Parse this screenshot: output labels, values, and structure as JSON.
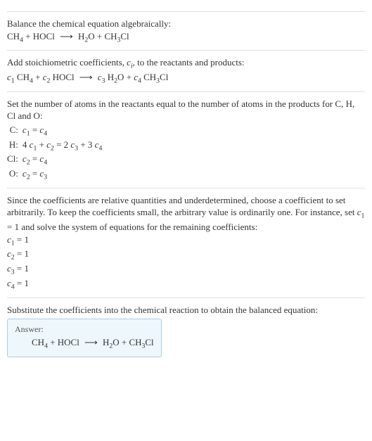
{
  "s1": {
    "intro": "Balance the chemical equation algebraically:",
    "eq_chunks": [
      "CH",
      "4",
      " + HOCl ",
      " H",
      "2",
      "O + CH",
      "3",
      "Cl"
    ]
  },
  "s2": {
    "intro_a": "Add stoichiometric coefficients, ",
    "intro_ci": "c",
    "intro_ci_sub": "i",
    "intro_b": ", to the reactants and products:",
    "eq": {
      "c1": "c",
      "c1s": "1",
      "r1a": " CH",
      "r1b": "4",
      "plus1": " + ",
      "c2": "c",
      "c2s": "2",
      "r2": " HOCl ",
      "c3": "c",
      "c3s": "3",
      "p1a": " H",
      "p1b": "2",
      "p1c": "O",
      "plus2": " + ",
      "c4": "c",
      "c4s": "4",
      "p2a": " CH",
      "p2b": "3",
      "p2c": "Cl"
    }
  },
  "s3": {
    "intro": "Set the number of atoms in the reactants equal to the number of atoms in the products for C, H, Cl and O:",
    "rows": [
      {
        "label": "C:",
        "lhs_pre": "",
        "c": "c",
        "cs": "1",
        "mid": " = ",
        "rc": "c",
        "rcs": "4",
        "tail": ""
      },
      {
        "label": "H:",
        "lhs_pre": "4 ",
        "c": "c",
        "cs": "1",
        "mid": " + ",
        "c2": "c",
        "c2s": "2",
        "eq": " = 2 ",
        "rc": "c",
        "rcs": "3",
        "plus": " + 3 ",
        "rc2": "c",
        "rc2s": "4"
      },
      {
        "label": "Cl:",
        "lhs_pre": "",
        "c": "c",
        "cs": "2",
        "mid": " = ",
        "rc": "c",
        "rcs": "4",
        "tail": ""
      },
      {
        "label": "O:",
        "lhs_pre": "",
        "c": "c",
        "cs": "2",
        "mid": " = ",
        "rc": "c",
        "rcs": "3",
        "tail": ""
      }
    ]
  },
  "s4": {
    "intro_a": "Since the coefficients are relative quantities and underdetermined, choose a coefficient to set arbitrarily. To keep the coefficients small, the arbitrary value is ordinarily one. For instance, set ",
    "c1": "c",
    "c1s": "1",
    "intro_b": " = 1 and solve the system of equations for the remaining coefficients:",
    "lines": [
      {
        "c": "c",
        "cs": "1",
        "val": " = 1"
      },
      {
        "c": "c",
        "cs": "2",
        "val": " = 1"
      },
      {
        "c": "c",
        "cs": "3",
        "val": " = 1"
      },
      {
        "c": "c",
        "cs": "4",
        "val": " = 1"
      }
    ]
  },
  "s5": {
    "intro": "Substitute the coefficients into the chemical reaction to obtain the balanced equation:",
    "answer_label": "Answer:",
    "eq_chunks": [
      "CH",
      "4",
      " + HOCl ",
      " H",
      "2",
      "O + CH",
      "3",
      "Cl"
    ]
  },
  "arrow": "⟶"
}
